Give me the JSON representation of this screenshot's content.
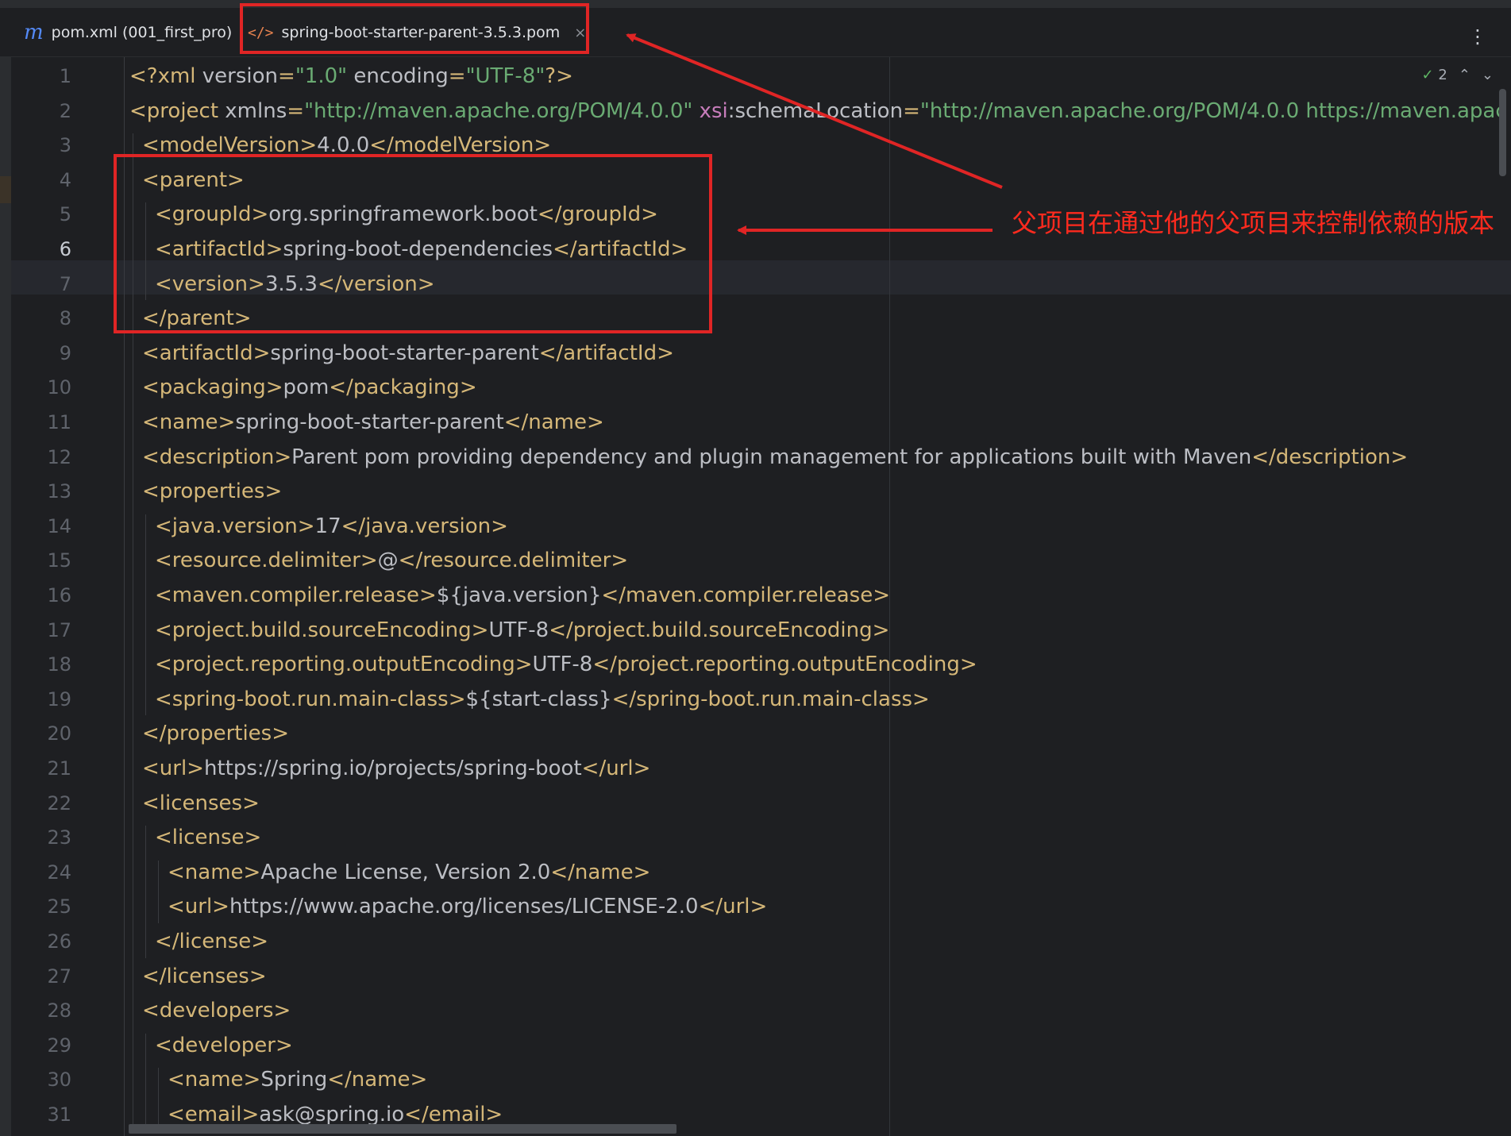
{
  "tabs": [
    {
      "icon": "m",
      "label": "pom.xml (001_first_pro)",
      "active": false
    },
    {
      "icon": "</>",
      "label": "spring-boot-starter-parent-3.5.3.pom",
      "active": true,
      "close": "×"
    }
  ],
  "toolbar": {
    "more": "⋮"
  },
  "inspection": {
    "check_icon": "✓",
    "count": "2",
    "up": "⌃",
    "down": "⌄"
  },
  "current_line": 6,
  "annotation": {
    "text": "父项目在通过他的父项目来控制依赖的版本",
    "color": "#ff2a1e"
  },
  "lines": [
    {
      "n": "1",
      "indent": 0,
      "parts": [
        [
          "tag",
          "<?xml "
        ],
        [
          "attr",
          "version"
        ],
        [
          "tag",
          "="
        ],
        [
          "val",
          "\"1.0\""
        ],
        [
          "attr",
          " encoding"
        ],
        [
          "tag",
          "="
        ],
        [
          "val",
          "\"UTF-8\""
        ],
        [
          "tag",
          "?>"
        ]
      ]
    },
    {
      "n": "2",
      "indent": 0,
      "parts": [
        [
          "tag",
          "<project "
        ],
        [
          "attr",
          "xmlns"
        ],
        [
          "tag",
          "="
        ],
        [
          "val",
          "\"http://maven.apache.org/POM/4.0.0\""
        ],
        [
          "attr",
          " "
        ],
        [
          "ns",
          "xsi"
        ],
        [
          "attr",
          ":schemaLocation"
        ],
        [
          "tag",
          "="
        ],
        [
          "val",
          "\"http://maven.apache.org/POM/4.0.0 https://maven.apac"
        ]
      ]
    },
    {
      "n": "3",
      "indent": 1,
      "parts": [
        [
          "tag",
          "<modelVersion>"
        ],
        [
          "txt",
          "4.0.0"
        ],
        [
          "tag",
          "</modelVersion>"
        ]
      ]
    },
    {
      "n": "4",
      "indent": 1,
      "parts": [
        [
          "tag",
          "<parent>"
        ]
      ]
    },
    {
      "n": "5",
      "indent": 2,
      "parts": [
        [
          "tag",
          "<groupId>"
        ],
        [
          "txt",
          "org.springframework.boot"
        ],
        [
          "tag",
          "</groupId>"
        ]
      ]
    },
    {
      "n": "6",
      "indent": 2,
      "parts": [
        [
          "tag",
          "<artifactId>"
        ],
        [
          "txt",
          "spring-boot-dependencies"
        ],
        [
          "tag",
          "</artifactId>"
        ]
      ]
    },
    {
      "n": "7",
      "indent": 2,
      "parts": [
        [
          "tag",
          "<version>"
        ],
        [
          "txt",
          "3.5.3"
        ],
        [
          "tag",
          "</version>"
        ]
      ]
    },
    {
      "n": "8",
      "indent": 1,
      "parts": [
        [
          "tag",
          "</parent>"
        ]
      ]
    },
    {
      "n": "9",
      "indent": 1,
      "parts": [
        [
          "tag",
          "<artifactId>"
        ],
        [
          "txt",
          "spring-boot-starter-parent"
        ],
        [
          "tag",
          "</artifactId>"
        ]
      ]
    },
    {
      "n": "10",
      "indent": 1,
      "parts": [
        [
          "tag",
          "<packaging>"
        ],
        [
          "txt",
          "pom"
        ],
        [
          "tag",
          "</packaging>"
        ]
      ]
    },
    {
      "n": "11",
      "indent": 1,
      "parts": [
        [
          "tag",
          "<name>"
        ],
        [
          "txt",
          "spring-boot-starter-parent"
        ],
        [
          "tag",
          "</name>"
        ]
      ]
    },
    {
      "n": "12",
      "indent": 1,
      "parts": [
        [
          "tag",
          "<description>"
        ],
        [
          "txt",
          "Parent pom providing dependency and plugin management for applications built with Maven"
        ],
        [
          "tag",
          "</description>"
        ]
      ]
    },
    {
      "n": "13",
      "indent": 1,
      "parts": [
        [
          "tag",
          "<properties>"
        ]
      ]
    },
    {
      "n": "14",
      "indent": 2,
      "parts": [
        [
          "tag",
          "<java.version>"
        ],
        [
          "txt",
          "17"
        ],
        [
          "tag",
          "</java.version>"
        ]
      ]
    },
    {
      "n": "15",
      "indent": 2,
      "parts": [
        [
          "tag",
          "<resource.delimiter>"
        ],
        [
          "txt",
          "@"
        ],
        [
          "tag",
          "</resource.delimiter>"
        ]
      ]
    },
    {
      "n": "16",
      "indent": 2,
      "parts": [
        [
          "tag",
          "<maven.compiler.release>"
        ],
        [
          "txt",
          "${java.version}"
        ],
        [
          "tag",
          "</maven.compiler.release>"
        ]
      ]
    },
    {
      "n": "17",
      "indent": 2,
      "parts": [
        [
          "tag",
          "<project.build.sourceEncoding>"
        ],
        [
          "txt",
          "UTF-8"
        ],
        [
          "tag",
          "</project.build.sourceEncoding>"
        ]
      ]
    },
    {
      "n": "18",
      "indent": 2,
      "parts": [
        [
          "tag",
          "<project.reporting.outputEncoding>"
        ],
        [
          "txt",
          "UTF-8"
        ],
        [
          "tag",
          "</project.reporting.outputEncoding>"
        ]
      ]
    },
    {
      "n": "19",
      "indent": 2,
      "parts": [
        [
          "tag",
          "<spring-boot.run.main-class>"
        ],
        [
          "txt",
          "${start-class}"
        ],
        [
          "tag",
          "</spring-boot.run.main-class>"
        ]
      ]
    },
    {
      "n": "20",
      "indent": 1,
      "parts": [
        [
          "tag",
          "</properties>"
        ]
      ]
    },
    {
      "n": "21",
      "indent": 1,
      "parts": [
        [
          "tag",
          "<url>"
        ],
        [
          "txt",
          "https://spring.io/projects/spring-boot"
        ],
        [
          "tag",
          "</url>"
        ]
      ]
    },
    {
      "n": "22",
      "indent": 1,
      "parts": [
        [
          "tag",
          "<licenses>"
        ]
      ]
    },
    {
      "n": "23",
      "indent": 2,
      "parts": [
        [
          "tag",
          "<license>"
        ]
      ]
    },
    {
      "n": "24",
      "indent": 3,
      "parts": [
        [
          "tag",
          "<name>"
        ],
        [
          "txt",
          "Apache License, Version 2.0"
        ],
        [
          "tag",
          "</name>"
        ]
      ]
    },
    {
      "n": "25",
      "indent": 3,
      "parts": [
        [
          "tag",
          "<url>"
        ],
        [
          "txt",
          "https://www.apache.org/licenses/LICENSE-2.0"
        ],
        [
          "tag",
          "</url>"
        ]
      ]
    },
    {
      "n": "26",
      "indent": 2,
      "parts": [
        [
          "tag",
          "</license>"
        ]
      ]
    },
    {
      "n": "27",
      "indent": 1,
      "parts": [
        [
          "tag",
          "</licenses>"
        ]
      ]
    },
    {
      "n": "28",
      "indent": 1,
      "parts": [
        [
          "tag",
          "<developers>"
        ]
      ]
    },
    {
      "n": "29",
      "indent": 2,
      "parts": [
        [
          "tag",
          "<developer>"
        ]
      ]
    },
    {
      "n": "30",
      "indent": 3,
      "parts": [
        [
          "tag",
          "<name>"
        ],
        [
          "txt",
          "Spring"
        ],
        [
          "tag",
          "</name>"
        ]
      ]
    },
    {
      "n": "31",
      "indent": 3,
      "parts": [
        [
          "tag",
          "<email>"
        ],
        [
          "txt",
          "ask@spring.io"
        ],
        [
          "tag",
          "</email>"
        ]
      ]
    }
  ]
}
